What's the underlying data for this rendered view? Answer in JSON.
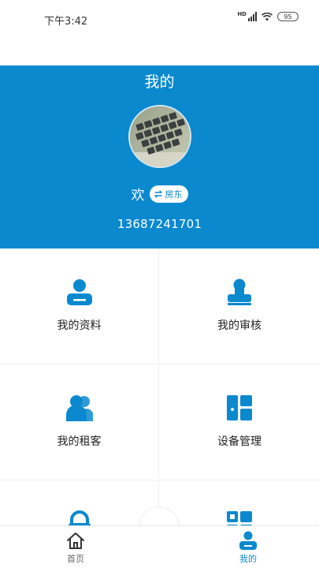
{
  "status_bar": {
    "time": "下午3:42",
    "network": "HD",
    "battery": "95"
  },
  "header": {
    "title": "我的",
    "welcome": "欢",
    "role_badge": "房东",
    "phone": "13687241701",
    "background_color": "#0a89cf"
  },
  "menu": {
    "items": [
      {
        "label": "我的资料",
        "icon": "user-profile-icon"
      },
      {
        "label": "我的审核",
        "icon": "audit-stamp-icon"
      },
      {
        "label": "我的租客",
        "icon": "tenants-icon"
      },
      {
        "label": "设备管理",
        "icon": "device-management-icon"
      },
      {
        "label": "",
        "icon": "lock-icon"
      },
      {
        "label": "",
        "icon": "qr-code-icon"
      }
    ]
  },
  "tabbar": {
    "tabs": [
      {
        "label": "首页",
        "icon": "home-icon",
        "active": false
      },
      {
        "label": "我的",
        "icon": "user-icon",
        "active": true
      }
    ],
    "active_color": "#0a89cf"
  }
}
